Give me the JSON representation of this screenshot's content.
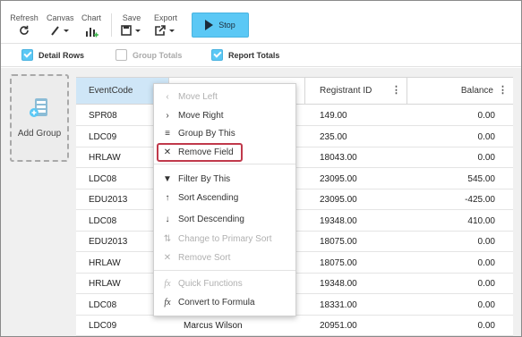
{
  "toolbar": {
    "refresh": {
      "label": "Refresh",
      "icon": "refresh-icon"
    },
    "canvas": {
      "label": "Canvas",
      "icon": "brush-icon"
    },
    "chart": {
      "label": "Chart",
      "icon": "bar-chart-icon"
    },
    "save": {
      "label": "Save",
      "icon": "save-icon"
    },
    "export": {
      "label": "Export",
      "icon": "export-icon"
    },
    "stop": {
      "label": "Stop",
      "icon": "play-icon"
    }
  },
  "options": {
    "detail_rows": {
      "label": "Detail Rows",
      "checked": true
    },
    "group_totals": {
      "label": "Group Totals",
      "checked": false
    },
    "report_totals": {
      "label": "Report Totals",
      "checked": true
    }
  },
  "add_group": {
    "label": "Add Group",
    "icon": "add-group-icon"
  },
  "grid": {
    "columns": [
      "EventCode",
      "",
      "Registrant ID",
      "Balance"
    ],
    "rows": [
      {
        "event": "SPR08",
        "name": "",
        "reg": "149.00",
        "bal": "0.00"
      },
      {
        "event": "LDC09",
        "name": "",
        "reg": "235.00",
        "bal": "0.00"
      },
      {
        "event": "HRLAW",
        "name": "",
        "reg": "18043.00",
        "bal": "0.00"
      },
      {
        "event": "LDC08",
        "name": "",
        "reg": "23095.00",
        "bal": "545.00"
      },
      {
        "event": "EDU2013",
        "name": "",
        "reg": "23095.00",
        "bal": "-425.00"
      },
      {
        "event": "LDC08",
        "name": "",
        "reg": "19348.00",
        "bal": "410.00"
      },
      {
        "event": "EDU2013",
        "name": "",
        "reg": "18075.00",
        "bal": "0.00"
      },
      {
        "event": "HRLAW",
        "name": "",
        "reg": "18075.00",
        "bal": "0.00"
      },
      {
        "event": "HRLAW",
        "name": "",
        "reg": "19348.00",
        "bal": "0.00"
      },
      {
        "event": "LDC08",
        "name": "",
        "reg": "18331.00",
        "bal": "0.00"
      },
      {
        "event": "LDC09",
        "name": "Marcus Wilson",
        "reg": "20951.00",
        "bal": "0.00"
      }
    ]
  },
  "context_menu": {
    "items": [
      {
        "label": "Move Left",
        "icon": "chevron-left-icon",
        "glyph": "‹",
        "enabled": false
      },
      {
        "label": "Move Right",
        "icon": "chevron-right-icon",
        "glyph": "›",
        "enabled": true
      },
      {
        "label": "Group By This",
        "icon": "group-lines-icon",
        "glyph": "≡",
        "enabled": true
      },
      {
        "label": "Remove Field",
        "icon": "close-icon",
        "glyph": "✕",
        "enabled": true
      },
      {
        "label": "Filter By This",
        "icon": "filter-icon",
        "glyph": "▼",
        "enabled": true
      },
      {
        "label": "Sort Ascending",
        "icon": "arrow-up-icon",
        "glyph": "↑",
        "enabled": true
      },
      {
        "label": "Sort Descending",
        "icon": "arrow-down-icon",
        "glyph": "↓",
        "enabled": true
      },
      {
        "label": "Change to Primary Sort",
        "icon": "primary-sort-icon",
        "glyph": "⇅",
        "enabled": false
      },
      {
        "label": "Remove Sort",
        "icon": "close-icon",
        "glyph": "✕",
        "enabled": false
      },
      {
        "label": "Quick Functions",
        "icon": "fx-icon",
        "glyph": "fx",
        "enabled": false
      },
      {
        "label": "Convert to Formula",
        "icon": "fx-icon",
        "glyph": "fx",
        "enabled": true
      }
    ],
    "highlighted": "Remove Field"
  },
  "colors": {
    "accent": "#5bc8f5",
    "highlight_box": "#c0394b",
    "selected_header": "#cfe6f7"
  }
}
